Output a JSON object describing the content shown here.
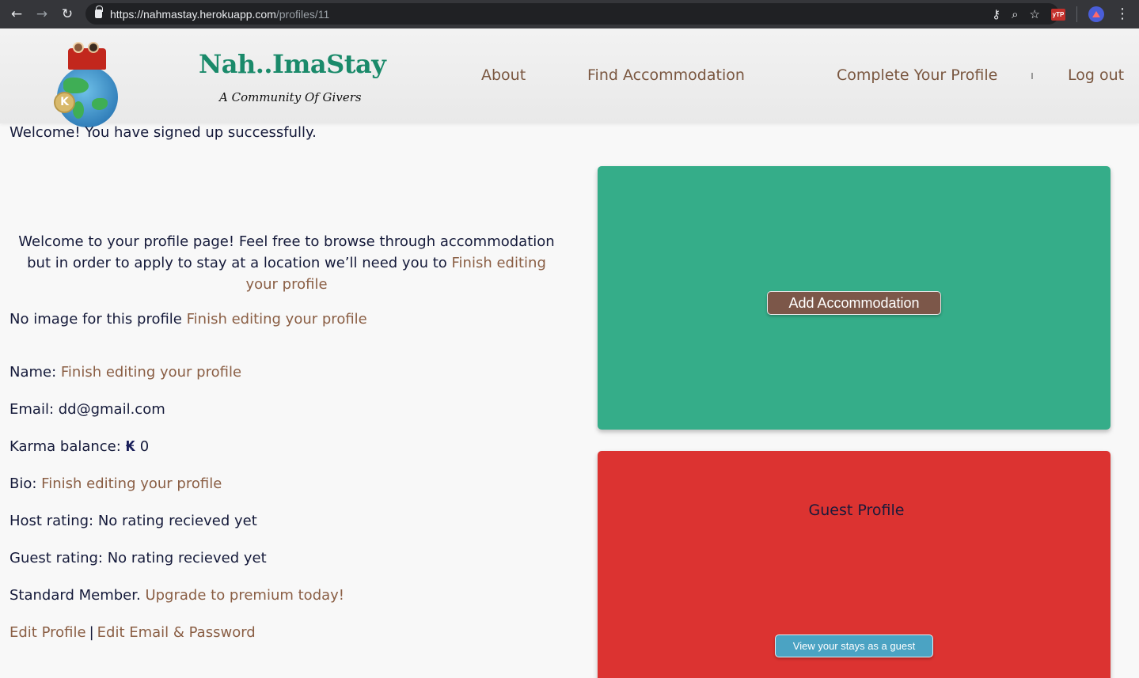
{
  "browser": {
    "url_host": "https://nahmastay.herokuapp.com",
    "url_path": "/profiles/11",
    "back_icon": "←",
    "forward_icon": "→",
    "reload_icon": "↻",
    "key_icon": "⚷",
    "zoom_icon": "⌕",
    "star_icon": "☆",
    "ext_label": "yTP",
    "menu_icon": "⋮"
  },
  "header": {
    "brand_title": "Nah..ImaStay",
    "brand_tagline": "A Community Of Givers",
    "coin_symbol": "K",
    "nav": {
      "about": "About",
      "find": "Find Accommodation",
      "complete": "Complete Your Profile",
      "logout": "Log out"
    }
  },
  "flash": "Welcome! You have signed up successfully.",
  "profile": {
    "intro_text": "Welcome to your profile page! Feel free to browse through accommodation but in order to apply to stay at a location we’ll need you to ",
    "intro_link": "Finish editing your profile",
    "image_label": "No image for this profile ",
    "image_link": "Finish editing your profile",
    "name_label": "Name: ",
    "name_link": "Finish editing your profile",
    "email_label": "Email: ",
    "email_value": "dd@gmail.com",
    "karma_label": "Karma balance: ",
    "karma_symbol": "₭",
    "karma_value": " 0",
    "bio_label": "Bio: ",
    "bio_link": "Finish editing your profile",
    "host_label": "Host rating: ",
    "host_value": "No rating recieved yet",
    "guest_label": "Guest rating: ",
    "guest_value": "No rating recieved yet",
    "member_label": "Standard Member. ",
    "member_link": "Upgrade to premium today!",
    "edit_profile": "Edit Profile",
    "divider": "|",
    "edit_email": "Edit Email & Password"
  },
  "host_card": {
    "button": "Add Accommodation",
    "color": "#35ad89"
  },
  "guest_card": {
    "title": "Guest Profile",
    "button": "View your stays as a guest",
    "color": "#dc3331"
  }
}
